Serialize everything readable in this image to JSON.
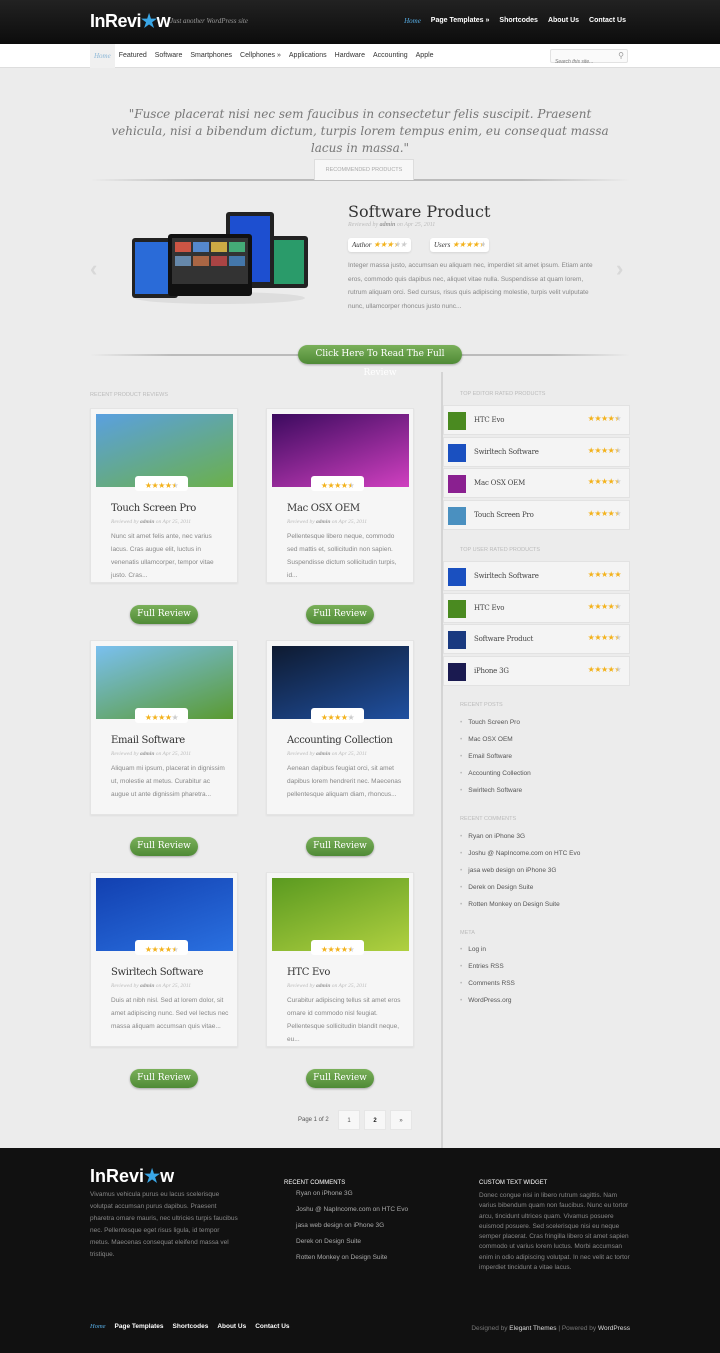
{
  "header": {
    "logo": {
      "text_before": "InRevi",
      "text_after": "w"
    },
    "tagline": "Just another WordPress site",
    "nav": [
      "Home",
      "Page Templates »",
      "Shortcodes",
      "About Us",
      "Contact Us"
    ]
  },
  "subnav": {
    "items": [
      "Home",
      "Featured",
      "Software",
      "Smartphones",
      "Cellphones »",
      "Applications",
      "Hardware",
      "Accounting",
      "Apple"
    ],
    "search_placeholder": "Search this site..."
  },
  "quote": "\"Fusce placerat nisi nec sem faucibus in consectetur felis suscipit. Praesent vehicula, nisi a bibendum dictum, turpis lorem tempus enim, eu consequat massa lacus in massa.\"",
  "featured": {
    "section_label": "Recommended Products",
    "title": "Software Product",
    "meta_prefix": "Reviewed by",
    "author": "admin",
    "meta_date": "on Apr 25, 2011",
    "author_label": "Author",
    "author_rating": 3.5,
    "users_label": "Users",
    "users_rating": 4.5,
    "description": "Integer massa justo, accumsan eu aliquam nec, imperdiet sit amet ipsum. Etiam ante eros, commodo quis dapibus nec, aliquet vitae nulla. Suspendisse at quam lorem, rutrum aliquam orci. Sed cursus, risus quis adipiscing molestie, turpis velit vulputate nunc, ullamcorper rhoncus justo nunc...",
    "cta": "Click Here To Read The Full Review"
  },
  "recent": {
    "label": "Recent Product Reviews",
    "button_label": "Full Review",
    "cards": [
      {
        "title": "Touch Screen Pro",
        "meta": "Reviewed by",
        "author": "admin",
        "date": "on Apr 25, 2011",
        "rating": 4.5,
        "desc": "Nunc sit amet felis ante, nec varius lacus. Cras augue elit, luctus in venenatis ullamcorper, tempor vitae justo. Cras..."
      },
      {
        "title": "Mac OSX OEM",
        "meta": "Reviewed by",
        "author": "admin",
        "date": "on Apr 25, 2011",
        "rating": 4.5,
        "desc": "Pellentesque libero neque, commodo sed mattis et, sollicitudin non sapien. Suspendisse dictum sollicitudin turpis, id..."
      },
      {
        "title": "Email Software",
        "meta": "Reviewed by",
        "author": "admin",
        "date": "on Apr 25, 2011",
        "rating": 4,
        "desc": "Aliquam mi ipsum, placerat in dignissim ut, molestie at metus. Curabitur ac augue ut ante dignissim pharetra..."
      },
      {
        "title": "Accounting Collection",
        "meta": "Reviewed by",
        "author": "admin",
        "date": "on Apr 25, 2011",
        "rating": 4,
        "desc": "Aenean dapibus feugiat orci, sit amet dapibus lorem hendrerit nec. Maecenas pellentesque aliquam diam, rhoncus..."
      },
      {
        "title": "Swirltech Software",
        "meta": "Reviewed by",
        "author": "admin",
        "date": "on Apr 25, 2011",
        "rating": 4.5,
        "desc": "Duis at nibh nisl. Sed at lorem dolor, sit amet adipiscing nunc. Sed vel lectus nec massa aliquam accumsan quis vitae..."
      },
      {
        "title": "HTC Evo",
        "meta": "Reviewed by",
        "author": "admin",
        "date": "on Apr 25, 2011",
        "rating": 4.5,
        "desc": "Curabitur adipiscing tellus sit amet eros ornare id commodo nisl feugiat. Pellentesque sollicitudin blandit neque, eu..."
      }
    ],
    "pagination": {
      "label": "Page 1 of 2",
      "pages": [
        "1",
        "2"
      ],
      "next": "»",
      "current": "2"
    }
  },
  "sidebar": {
    "editor_label": "Top Editor Rated Products",
    "editor": [
      {
        "name": "HTC Evo",
        "rating": 4.5
      },
      {
        "name": "Swirltech Software",
        "rating": 4.5
      },
      {
        "name": "Mac OSX OEM",
        "rating": 4.5
      },
      {
        "name": "Touch Screen Pro",
        "rating": 4.5
      }
    ],
    "user_label": "Top User Rated Products",
    "user": [
      {
        "name": "Swirltech Software",
        "rating": 5
      },
      {
        "name": "HTC Evo",
        "rating": 4.5
      },
      {
        "name": "Software Product",
        "rating": 4.5
      },
      {
        "name": "iPhone 3G",
        "rating": 4.5
      }
    ],
    "posts_label": "Recent Posts",
    "posts": [
      "Touch Screen Pro",
      "Mac OSX OEM",
      "Email Software",
      "Accounting Collection",
      "Swirltech Software"
    ],
    "comments_label": "Recent Comments",
    "comments": [
      "Ryan on iPhone 3G",
      "Joshu @ NapIncome.com on HTC Evo",
      "jasa web design on iPhone 3G",
      "Derek on Design Suite",
      "Rotten Monkey on Design Suite"
    ],
    "meta_label": "Meta",
    "meta": [
      "Log in",
      "Entries RSS",
      "Comments RSS",
      "WordPress.org"
    ]
  },
  "footer": {
    "about": "Vivamus vehicula purus eu lacus scelerisque volutpat accumsan purus dapibus. Praesent pharetra ornare mauris, nec ultricies turpis faucibus nec. Pellentesque eget risus ligula, id tempor metus. Maecenas consequat eleifend massa vel tristique.",
    "comments_label": "Recent Comments",
    "comments": [
      "Ryan on iPhone 3G",
      "Joshu @ NapIncome.com on HTC Evo",
      "jasa web design on iPhone 3G",
      "Derek on Design Suite",
      "Rotten Monkey on Design Suite"
    ],
    "widget_label": "Custom Text Widget",
    "widget_text": "Donec congue nisi in libero rutrum sagittis. Nam varius bibendum quam non faucibus. Nunc eu tortor arcu, tincidunt ultrices quam. Vivamus posuere euismod posuere. Sed scelerisque nisi eu neque semper placerat. Cras fringilla libero sit amet sapien commodo ut varius lorem luctus. Morbi accumsan enim in odio adipiscing volutpat. In nec velit ac tortor imperdiet tincidunt a vitae lacus.",
    "nav": [
      "Home",
      "Page Templates",
      "Shortcodes",
      "About Us",
      "Contact Us"
    ],
    "credit_prefix": "Designed by",
    "credit_theme": "Elegant Themes",
    "credit_mid": "| Powered by",
    "credit_platform": "WordPress"
  },
  "colors": {
    "accent_blue": "#3aa6e6",
    "button_green": "#5e9a44",
    "star": "#f3b21c",
    "header_bg": "#111111"
  }
}
